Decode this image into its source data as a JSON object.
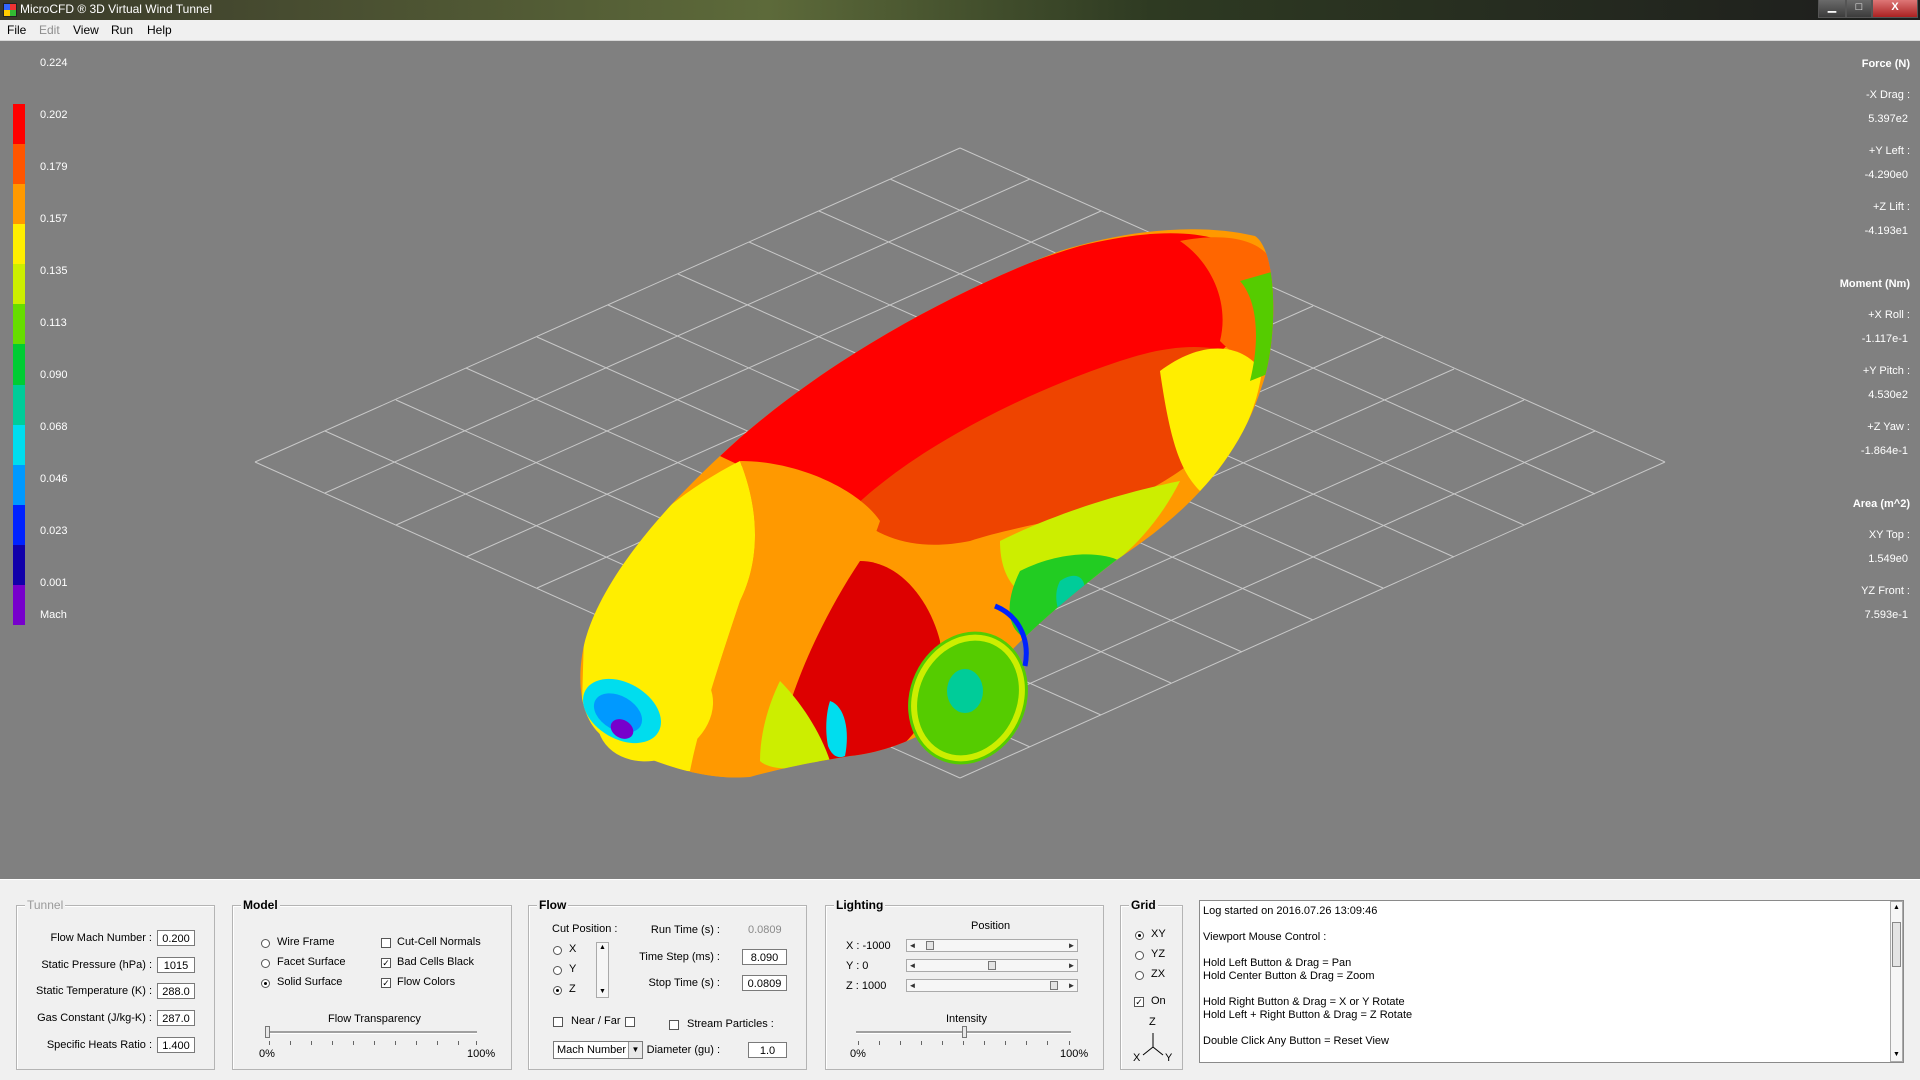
{
  "window": {
    "title": "MicroCFD ® 3D Virtual Wind Tunnel",
    "min_glyph": "▁",
    "max_glyph": "□",
    "close_glyph": "X"
  },
  "menu": [
    {
      "label": "File",
      "enabled": true
    },
    {
      "label": "Edit",
      "enabled": false
    },
    {
      "label": "View",
      "enabled": true
    },
    {
      "label": "Run",
      "enabled": true
    },
    {
      "label": "Help",
      "enabled": true
    }
  ],
  "legend": {
    "values": [
      "0.224",
      "0.202",
      "0.179",
      "0.157",
      "0.135",
      "0.113",
      "0.090",
      "0.068",
      "0.046",
      "0.023",
      "0.001"
    ],
    "unit": "Mach",
    "colors": [
      "#ff0000",
      "#ff5500",
      "#ff9900",
      "#ffee00",
      "#ccee00",
      "#66dd00",
      "#00cc33",
      "#00cc99",
      "#00ddee",
      "#0099ff",
      "#0022ff",
      "#1100aa",
      "#7700cc"
    ]
  },
  "readouts": {
    "force_title": "Force (N)",
    "drag_label": "-X  Drag :",
    "drag_value": "5.397e2",
    "left_label": "+Y  Left :",
    "left_value": "-4.290e0",
    "lift_label": "+Z  Lift :",
    "lift_value": "-4.193e1",
    "moment_title": "Moment (Nm)",
    "roll_label": "+X  Roll :",
    "roll_value": "-1.117e-1",
    "pitch_label": "+Y  Pitch :",
    "pitch_value": "4.530e2",
    "yaw_label": "+Z  Yaw :",
    "yaw_value": "-1.864e-1",
    "area_title": "Area (m^2)",
    "top_label": "XY  Top :",
    "top_value": "1.549e0",
    "front_label": "YZ  Front :",
    "front_value": "7.593e-1"
  },
  "tunnel": {
    "title": "Tunnel",
    "mach_label": "Flow Mach Number :",
    "mach_value": "0.200",
    "pressure_label": "Static Pressure (hPa) :",
    "pressure_value": "1015",
    "temp_label": "Static Temperature (K) :",
    "temp_value": "288.0",
    "gas_label": "Gas Constant (J/kg-K) :",
    "gas_value": "287.0",
    "heats_label": "Specific Heats Ratio :",
    "heats_value": "1.400"
  },
  "model": {
    "title": "Model",
    "wire_frame": "Wire Frame",
    "facet_surface": "Facet Surface",
    "solid_surface": "Solid Surface",
    "selected": "Solid Surface",
    "cut_cell_normals": "Cut-Cell Normals",
    "cut_cell_normals_checked": false,
    "bad_cells_black": "Bad Cells Black",
    "bad_cells_black_checked": true,
    "flow_colors": "Flow Colors",
    "flow_colors_checked": true,
    "transparency_label": "Flow Transparency",
    "transparency_min": "0%",
    "transparency_max": "100%",
    "transparency_level": 0.0
  },
  "flow": {
    "title": "Flow",
    "cut_position_label": "Cut Position :",
    "axis_x": "X",
    "axis_y": "Y",
    "axis_z": "Z",
    "cut_selected": "Z",
    "near_far_label": "Near / Far",
    "run_time_label": "Run Time (s) :",
    "run_time_value": "0.0809",
    "time_step_label": "Time Step (ms) :",
    "time_step_value": "8.090",
    "stop_time_label": "Stop Time (s) :",
    "stop_time_value": "0.0809",
    "stream_particles_label": "Stream Particles :",
    "diameter_label": "Diameter (gu) :",
    "diameter_value": "1.0",
    "variable_selected": "Mach Number",
    "dropdown_glyph": "▼",
    "up_glyph": "▲",
    "down_glyph": "▼"
  },
  "lighting": {
    "title": "Lighting",
    "position_label": "Position",
    "x_label": "X  :  -1000",
    "x_level": 0.05,
    "y_label": "Y  :  0",
    "y_level": 0.5,
    "z_label": "Z  :  1000",
    "z_level": 0.95,
    "intensity_label": "Intensity",
    "intensity_min": "0%",
    "intensity_max": "100%",
    "intensity_level": 0.5,
    "left_arrow": "◄",
    "right_arrow": "►"
  },
  "grid": {
    "title": "Grid",
    "xy": "XY",
    "yz": "YZ",
    "zx": "ZX",
    "selected": "XY",
    "on_label": "On",
    "on_checked": true,
    "axis_z": "Z",
    "axis_x": "X",
    "axis_y": "Y"
  },
  "log": {
    "lines": [
      "Log started on 2016.07.26 13:09:46",
      "",
      "Viewport Mouse Control :",
      "",
      "Hold Left Button & Drag  =  Pan",
      "Hold Center Button & Drag  =  Zoom",
      "",
      "Hold Right Button & Drag  =  X or Y Rotate",
      "Hold Left + Right Button & Drag  =  Z Rotate",
      "",
      "Double Click Any Button  =  Reset View"
    ],
    "up_glyph": "▲",
    "down_glyph": "▼"
  }
}
